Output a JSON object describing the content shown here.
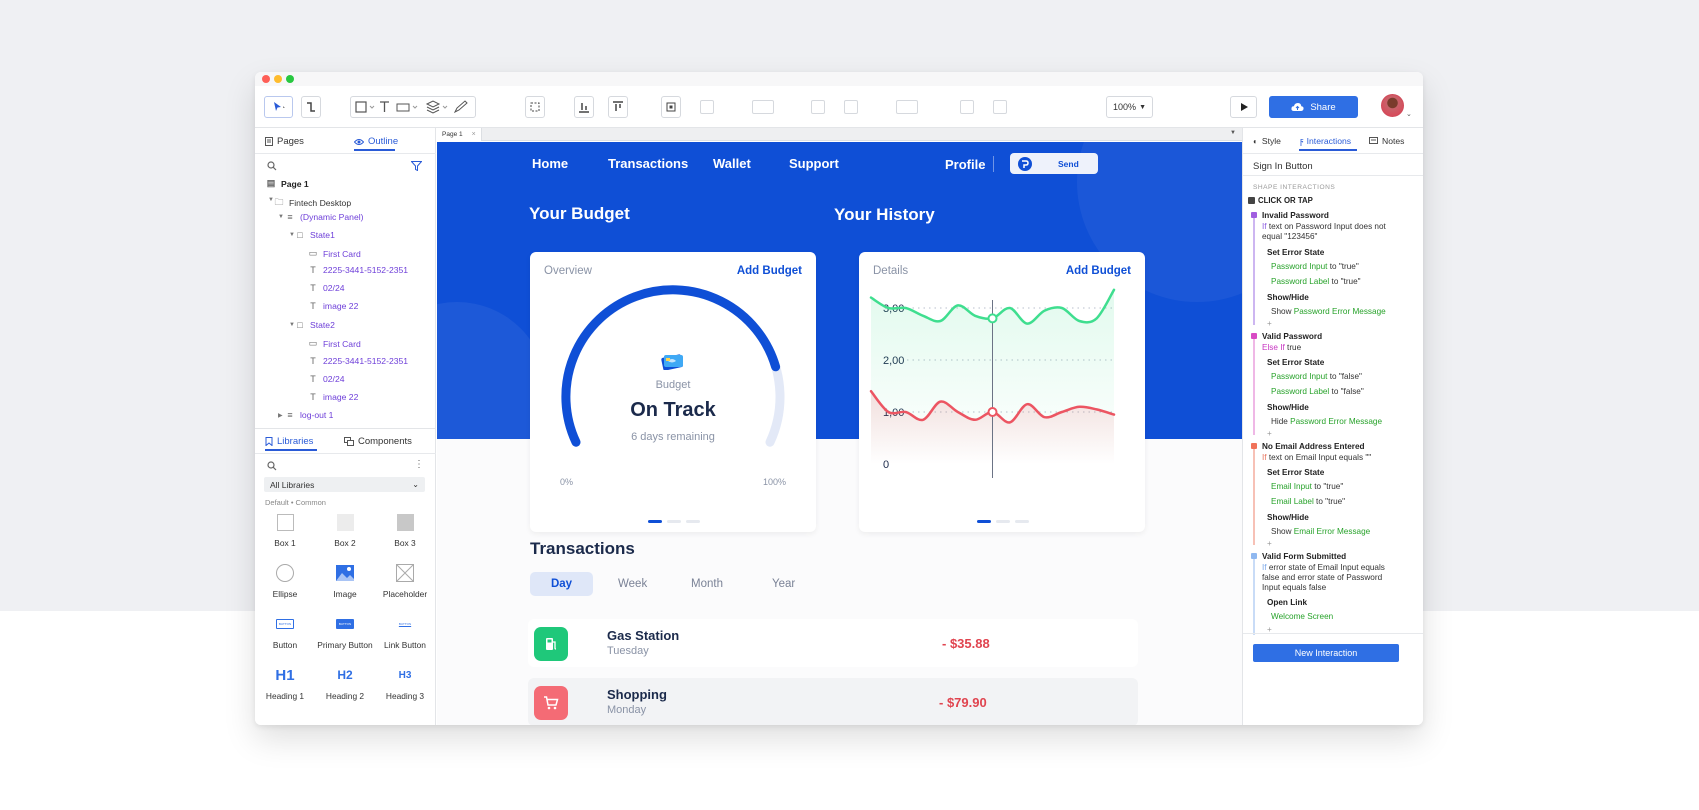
{
  "toolbar": {
    "zoom": "100%",
    "share_label": "Share"
  },
  "left_panel": {
    "tabs": {
      "pages": "Pages",
      "outline": "Outline"
    },
    "tree": {
      "page1": "Page 1",
      "fintech": "Fintech Desktop",
      "dynamic_panel": "(Dynamic Panel)",
      "state1": "State1",
      "s1_card": "First Card",
      "s1_number": "2225-3441-5152-2351",
      "s1_date": "02/24",
      "s1_image": "image 22",
      "state2": "State2",
      "s2_card": "First Card",
      "s2_number": "2225-3441-5152-2351",
      "s2_date": "02/24",
      "s2_image": "image 22",
      "logout": "log-out 1"
    },
    "lib_tabs": {
      "libraries": "Libraries",
      "components": "Components"
    },
    "library_select": "All Libraries",
    "library_sub": "Default • Common",
    "widgets": [
      "Box 1",
      "Box 2",
      "Box 3",
      "Ellipse",
      "Image",
      "Placeholder",
      "Button",
      "Primary Button",
      "Link Button",
      "Heading 1",
      "Heading 2",
      "Heading 3"
    ],
    "button_mini": "BUTTON",
    "headings": [
      "H1",
      "H2",
      "H3"
    ]
  },
  "canvas": {
    "page_tab": "Page 1",
    "nav": [
      "Home",
      "Transactions",
      "Wallet",
      "Support"
    ],
    "profile": "Profile",
    "send": "Send",
    "budget": {
      "section_title": "Your Budget",
      "card_title": "Overview",
      "add": "Add Budget",
      "label": "Budget",
      "status": "On Track",
      "remaining": "6 days remaining",
      "min": "0%",
      "max": "100%",
      "progress": 0.82
    },
    "history": {
      "section_title": "Your History",
      "card_title": "Details",
      "add": "Add Budget",
      "y_ticks": [
        "3,00",
        "2,00",
        "1,00",
        "0"
      ]
    },
    "transactions": {
      "title": "Transactions",
      "periods": [
        "Day",
        "Week",
        "Month",
        "Year"
      ],
      "active_period": "Day",
      "rows": [
        {
          "name": "Gas Station",
          "day": "Tuesday",
          "amount": "- $35.88",
          "color": "#1fc87a"
        },
        {
          "name": "Shopping",
          "day": "Monday",
          "amount": "- $79.90",
          "color": "#f46b75"
        }
      ]
    }
  },
  "chart_data": {
    "type": "line",
    "title": "Your History",
    "ylim": [
      0,
      3.5
    ],
    "y_ticks": [
      "3,00",
      "2,00",
      "1,00",
      "0"
    ],
    "grid": true,
    "series": [
      {
        "color": "#3fde8f",
        "values": [
          3.2,
          3.0,
          3.0,
          2.85,
          2.75,
          3.05,
          2.85,
          2.8,
          3.0,
          2.7,
          2.95,
          3.0,
          2.75,
          2.8,
          3.35
        ]
      },
      {
        "color": "#ec5562",
        "values": [
          1.4,
          1.0,
          1.0,
          0.85,
          1.2,
          1.0,
          0.85,
          1.0,
          0.8,
          1.15,
          0.9,
          1.0,
          1.1,
          1.05,
          0.95
        ]
      }
    ],
    "highlight_index": 7
  },
  "right_panel": {
    "tabs": {
      "style": "Style",
      "interactions": "Interactions",
      "notes": "Notes"
    },
    "element": "Sign In Button",
    "section": "SHAPE INTERACTIONS",
    "event": "CLICK OR TAP",
    "cases": [
      {
        "name": "Invalid Password",
        "kw": "If",
        "cond": "text on Password Input does not",
        "cond2": "equal \"123456\"",
        "color": "#a05ee0",
        "actions": [
          {
            "title": "Set Error State",
            "items": [
              {
                "target": "Password Input",
                "rest": " to \"true\""
              },
              {
                "target": "Password Label",
                "rest": " to \"true\""
              }
            ]
          },
          {
            "title": "Show/Hide",
            "items": [
              {
                "pre": "Show ",
                "target": "Password Error Message",
                "rest": ""
              }
            ]
          }
        ]
      },
      {
        "name": "Valid Password",
        "kw": "Else If",
        "cond": "true",
        "color": "#d84bc4",
        "actions": [
          {
            "title": "Set Error State",
            "items": [
              {
                "target": "Password Input",
                "rest": " to \"false\""
              },
              {
                "target": "Password Label",
                "rest": " to \"false\""
              }
            ]
          },
          {
            "title": "Show/Hide",
            "items": [
              {
                "pre": "Hide ",
                "target": "Password Error Message",
                "rest": ""
              }
            ]
          }
        ]
      },
      {
        "name": "No Email Address Entered",
        "kw": "If",
        "cond": "text on Email Input equals \"\"",
        "color": "#f0725a",
        "actions": [
          {
            "title": "Set Error State",
            "items": [
              {
                "target": "Email Input",
                "rest": " to \"true\""
              },
              {
                "target": "Email Label",
                "rest": " to \"true\""
              }
            ]
          },
          {
            "title": "Show/Hide",
            "items": [
              {
                "pre": "Show ",
                "target": "Email Error Message",
                "rest": ""
              }
            ]
          }
        ]
      },
      {
        "name": "Valid Form Submitted",
        "kw": "If",
        "cond": "error state of Email Input equals",
        "cond2": "false and error state of Password",
        "cond3": "Input equals false",
        "color": "#8fb8f0",
        "actions": [
          {
            "title": "Open Link",
            "items": [
              {
                "target": "Welcome Screen",
                "rest": ""
              }
            ]
          }
        ]
      }
    ],
    "plus": "+",
    "new_button": "New Interaction"
  }
}
